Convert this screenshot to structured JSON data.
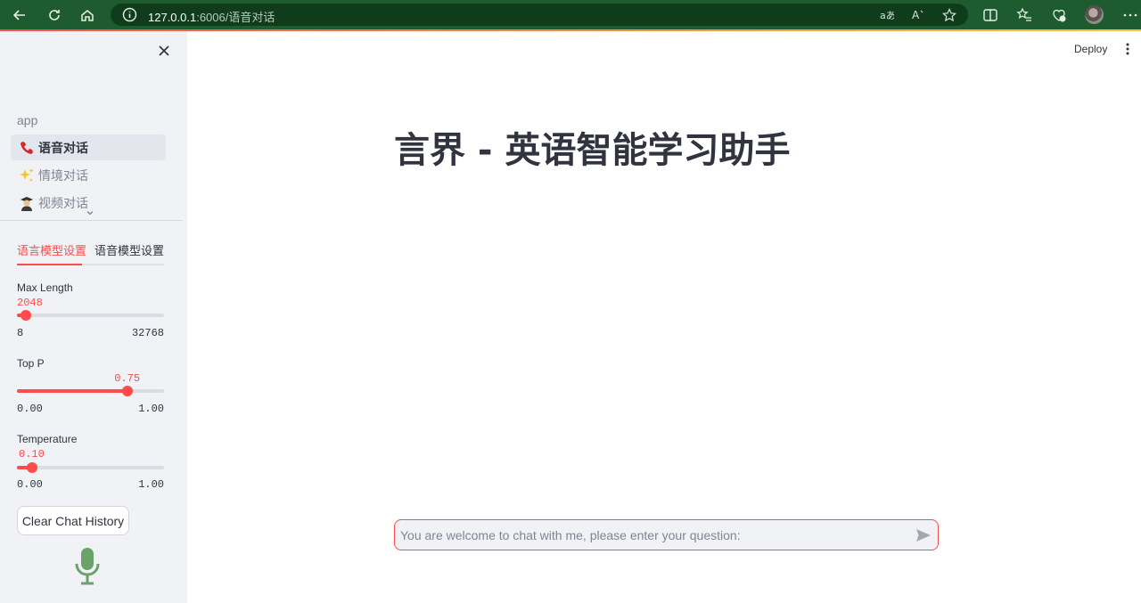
{
  "browser": {
    "url_host": "127.0.0.1",
    "url_path": ":6006/语音对话"
  },
  "sidebar": {
    "nav_header": "app",
    "nav_items": [
      {
        "emoji": "phone",
        "label": "语音对话",
        "active": true
      },
      {
        "emoji": "sparkles",
        "label": "情境对话",
        "active": false
      },
      {
        "emoji": "student",
        "label": "视频对话",
        "active": false
      }
    ],
    "tabs": [
      {
        "label": "语言模型设置",
        "active": true
      },
      {
        "label": "语音模型设置",
        "active": false
      }
    ],
    "sliders": [
      {
        "label": "Max Length",
        "value": "2048",
        "min": "8",
        "max": "32768",
        "fraction": 0.062
      },
      {
        "label": "Top P",
        "value": "0.75",
        "min": "0.00",
        "max": "1.00",
        "fraction": 0.75
      },
      {
        "label": "Temperature",
        "value": "0.10",
        "min": "0.00",
        "max": "1.00",
        "fraction": 0.1
      }
    ],
    "clear_button": "Clear Chat History"
  },
  "header": {
    "deploy_label": "Deploy"
  },
  "main": {
    "title": "言界 - 英语智能学习助手",
    "chat_placeholder": "You are welcome to chat with me, please enter your question:"
  },
  "colors": {
    "accent": "#ff4b4b",
    "browser_bar": "#1e5b2e",
    "sidebar_bg": "#f0f2f6",
    "mic": "#6aa36a"
  }
}
